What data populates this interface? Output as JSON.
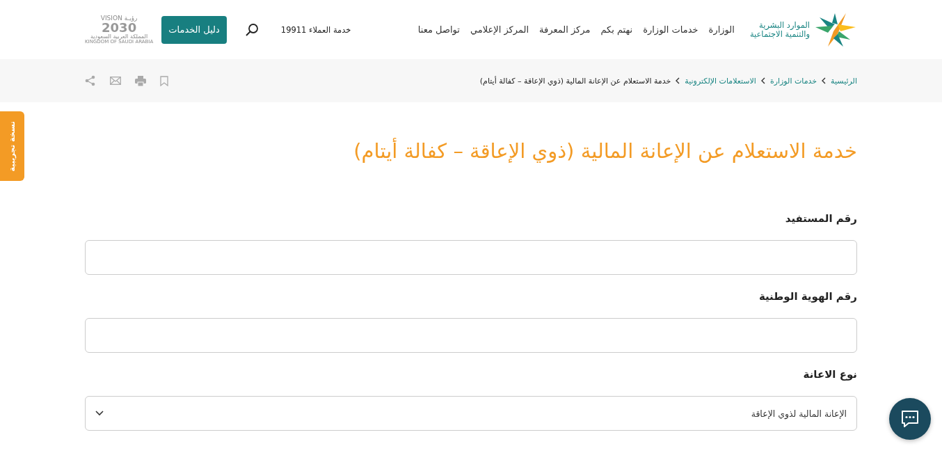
{
  "header": {
    "logo": {
      "line_1": "الموارد البشرية",
      "line_2": "والتنمية الاجتماعية"
    },
    "nav": [
      {
        "label": "الوزارة"
      },
      {
        "label": "خدمات الوزارة"
      },
      {
        "label": "نهتم بكم"
      },
      {
        "label": "مركز المعرفة"
      },
      {
        "label": "المركز الإعلامي"
      },
      {
        "label": "تواصل معنا"
      }
    ],
    "customer_service": "خدمة العملاء 19911",
    "services_button": "دليل الخدمات",
    "vision_logo": {
      "vision": "VISION",
      "ruya": "رؤيـة",
      "year": "2030",
      "country_ar": "المملكة العربية السعودية",
      "country_en": "KINGDOM OF SAUDI ARABIA"
    }
  },
  "breadcrumb": [
    {
      "label": "الرئيسية",
      "current": false
    },
    {
      "label": "خدمات الوزارة",
      "current": false
    },
    {
      "label": "الاستعلامات الإلكترونية",
      "current": false
    },
    {
      "label": "خدمة الاستعلام عن الإعانة المالية (ذوي الإعاقة – كفالة أيتام)",
      "current": true
    }
  ],
  "beta_tab": "نسخة تجريبية",
  "title": "خدمة الاستعلام عن الإعانة المالية (ذوي الإعاقة – كفالة أيتام)",
  "form": {
    "fields": [
      {
        "kind": "text",
        "label": "رقم المستفيد"
      },
      {
        "kind": "text",
        "label": "رقم الهوية الوطنية"
      },
      {
        "kind": "select",
        "label": "نوع الاعانة",
        "value": "الإعانة المالية لذوي الإعاقة"
      }
    ]
  }
}
